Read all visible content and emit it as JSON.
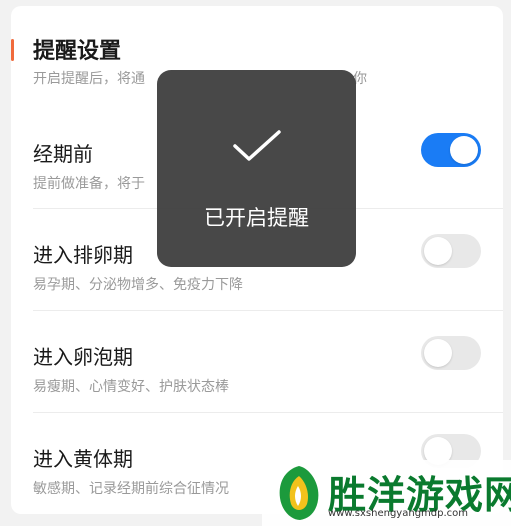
{
  "section": {
    "title": "提醒设置",
    "description_visible_start": "开启提醒后，将通",
    "description_visible_end": "你"
  },
  "items": [
    {
      "title": "经期前",
      "description": "提前做准备，将于",
      "enabled": true
    },
    {
      "title": "进入排卵期",
      "description": "易孕期、分泌物增多、免疫力下降",
      "enabled": false
    },
    {
      "title": "进入卵泡期",
      "description": "易瘦期、心情变好、护肤状态棒",
      "enabled": false
    },
    {
      "title": "进入黄体期",
      "description": "敏感期、记录经期前综合征情况",
      "enabled": false
    }
  ],
  "toast": {
    "message": "已开启提醒",
    "icon": "checkmark-icon"
  },
  "watermark": {
    "name": "胜洋游戏网",
    "url": "www.sxshengyangmdp.com"
  },
  "colors": {
    "accent": "#1a7cf5",
    "section_marker": "#f06a3c",
    "watermark": "#0a7a2e"
  }
}
